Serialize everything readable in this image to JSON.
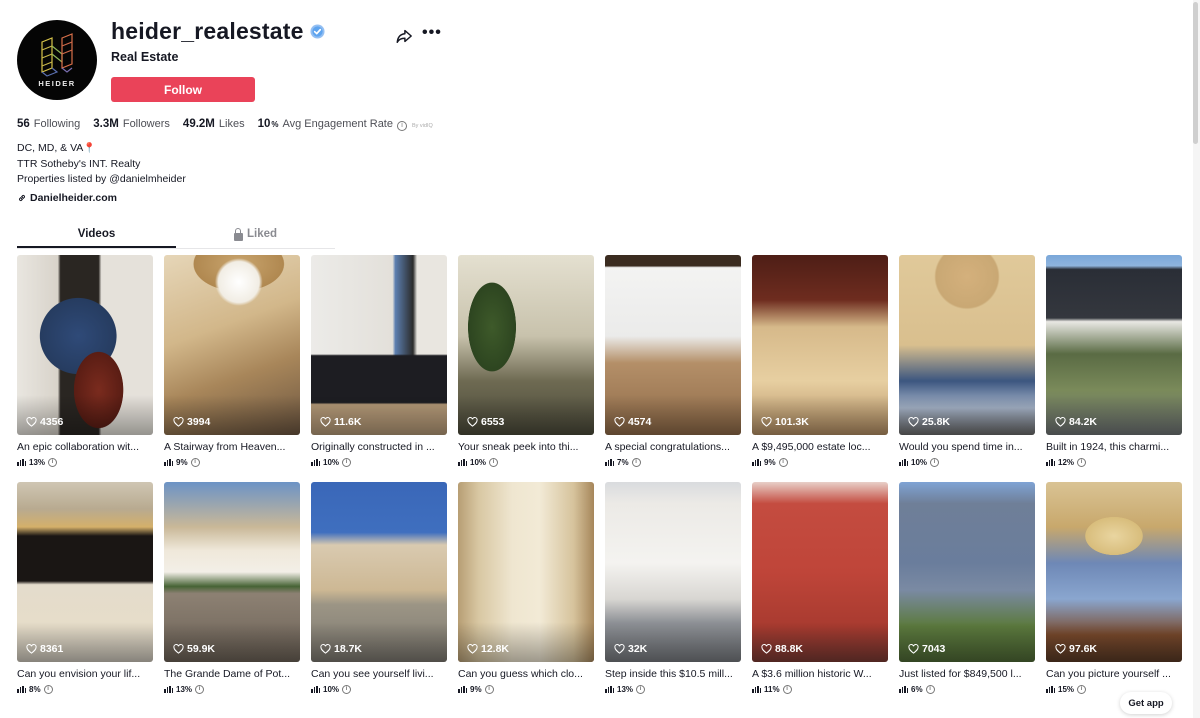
{
  "profile": {
    "username": "heider_realestate",
    "verified": true,
    "category": "Real Estate",
    "avatar_text": "HEIDER",
    "follow_label": "Follow",
    "share_icon": "share-icon",
    "more_icon": "more-icon",
    "more_glyph": "•••"
  },
  "stats": {
    "following_count": "56",
    "following_label": "Following",
    "followers_count": "3.3M",
    "followers_label": "Followers",
    "likes_count": "49.2M",
    "likes_label": "Likes",
    "engagement_value": "10",
    "engagement_unit": "%",
    "engagement_label": "Avg Engagement Rate",
    "engagement_source": "By vidIQ"
  },
  "bio": {
    "line1": "DC, MD, & VA",
    "line1_emoji": "📍",
    "line2": "TTR Sotheby's INT. Realty",
    "line3": "Properties listed by @danielmheider",
    "link": "Danielheider.com"
  },
  "tabs": [
    {
      "label": "Videos",
      "active": true
    },
    {
      "label": "Liked",
      "active": false,
      "icon": "lock-icon"
    }
  ],
  "videos": [
    {
      "likes": "4356",
      "caption": "An epic collaboration wit...",
      "engagement": "13%",
      "scene": "cello"
    },
    {
      "likes": "3994",
      "caption": "A Stairway from Heaven...",
      "engagement": "9%",
      "scene": "stair"
    },
    {
      "likes": "11.6K",
      "caption": "Originally constructed in ...",
      "engagement": "10%",
      "scene": "kitchen"
    },
    {
      "likes": "6553",
      "caption": "Your sneak peek into thi...",
      "engagement": "10%",
      "scene": "sunroom"
    },
    {
      "likes": "4574",
      "caption": "A special congratulations...",
      "engagement": "7%",
      "scene": "hall"
    },
    {
      "likes": "101.3K",
      "caption": "A $9,495,000 estate loc...",
      "engagement": "9%",
      "scene": "arches"
    },
    {
      "likes": "25.8K",
      "caption": "Would you spend time in...",
      "engagement": "10%",
      "scene": "foyer"
    },
    {
      "likes": "84.2K",
      "caption": "Built in 1924, this charmi...",
      "engagement": "12%",
      "scene": "porch"
    },
    {
      "likes": "8361",
      "caption": "Can you envision your lif...",
      "engagement": "8%",
      "scene": "fireplace"
    },
    {
      "likes": "59.9K",
      "caption": "The Grande Dame of Pot...",
      "engagement": "13%",
      "scene": "mansion"
    },
    {
      "likes": "18.7K",
      "caption": "Can you see yourself livi...",
      "engagement": "10%",
      "scene": "estate"
    },
    {
      "likes": "12.8K",
      "caption": "Can you guess which clo...",
      "engagement": "9%",
      "scene": "closet"
    },
    {
      "likes": "32K",
      "caption": "Step inside this $10.5 mill...",
      "engagement": "13%",
      "scene": "modern"
    },
    {
      "likes": "88.8K",
      "caption": "A $3.6 million historic W...",
      "engagement": "11%",
      "scene": "redhouse"
    },
    {
      "likes": "7043",
      "caption": "Just listed for $849,500 l...",
      "engagement": "6%",
      "scene": "bluehouse"
    },
    {
      "likes": "97.6K",
      "caption": "Can you picture yourself ...",
      "engagement": "15%",
      "scene": "ceiling"
    }
  ],
  "get_app_label": "Get app",
  "colors": {
    "follow_button": "#ea4359",
    "text_primary": "#161823",
    "text_secondary": "#8a8b91",
    "verified_badge": "#20d5ec"
  }
}
